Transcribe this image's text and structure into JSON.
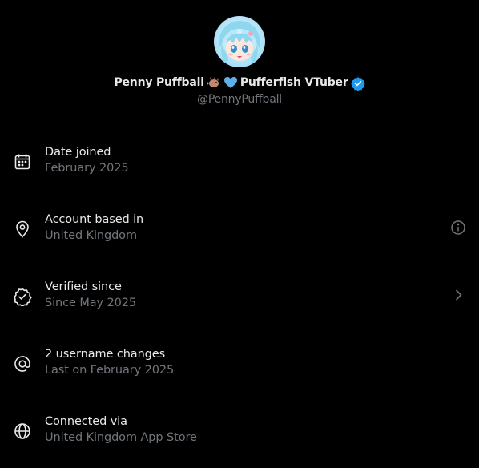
{
  "profile": {
    "display_name_before": "Penny Puffball",
    "display_name_after": "Pufferfish VTuber",
    "handle": "@PennyPuffball",
    "emoji_1": "pufferfish-emoji",
    "emoji_2": "blue-heart-emoji",
    "verified_badge_color": "#1d9bf0"
  },
  "rows": [
    {
      "icon": "calendar-icon",
      "title": "Date joined",
      "subtitle": "February 2025",
      "trailing": ""
    },
    {
      "icon": "location-pin-icon",
      "title": "Account based in",
      "subtitle": "United Kingdom",
      "trailing": "info-icon"
    },
    {
      "icon": "verified-check-icon",
      "title": "Verified since",
      "subtitle": "Since May 2025",
      "trailing": "chevron-right-icon"
    },
    {
      "icon": "at-sign-icon",
      "title": "2 username changes",
      "subtitle": "Last on February 2025",
      "trailing": ""
    },
    {
      "icon": "globe-icon",
      "title": "Connected via",
      "subtitle": "United Kingdom App Store",
      "trailing": ""
    }
  ],
  "colors": {
    "background": "#000000",
    "primary_text": "#e7e9ea",
    "secondary_text": "#71767b",
    "accent": "#1d9bf0"
  }
}
